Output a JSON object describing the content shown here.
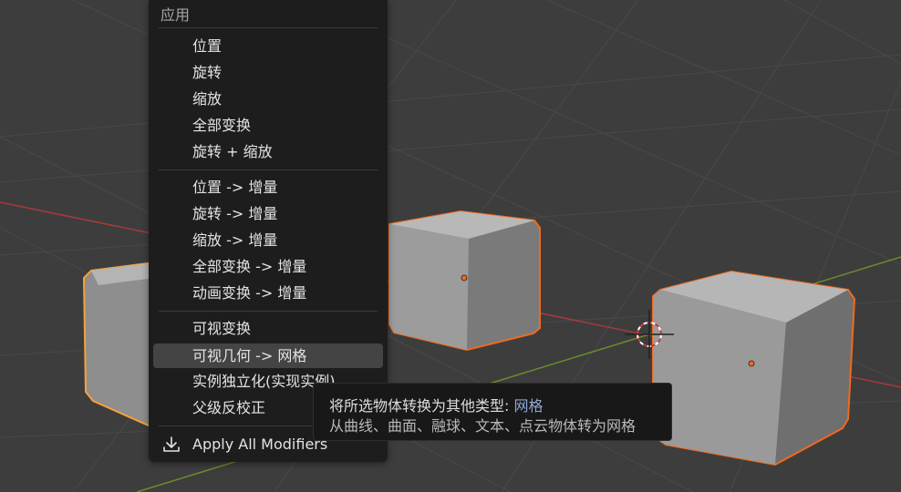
{
  "menu": {
    "title": "应用",
    "items": [
      {
        "label": "位置"
      },
      {
        "label": "旋转"
      },
      {
        "label": "缩放"
      },
      {
        "label": "全部变换"
      },
      {
        "label": "旋转 + 缩放"
      },
      {
        "label": "位置 -> 增量"
      },
      {
        "label": "旋转 -> 增量"
      },
      {
        "label": "缩放 -> 增量"
      },
      {
        "label": "全部变换 -> 增量"
      },
      {
        "label": "动画变换 -> 增量"
      },
      {
        "label": "可视变换"
      },
      {
        "label": "可视几何 -> 网格",
        "highlighted": true
      },
      {
        "label": "实例独立化(实现实例)"
      },
      {
        "label": "父级反校正"
      },
      {
        "label": "Apply All Modifiers",
        "icon": "download-icon"
      }
    ]
  },
  "tooltip": {
    "prefix": "将所选物体转换为其他类型: ",
    "accent": "网格",
    "description": "从曲线、曲面、融球、文本、点云物体转为网格"
  },
  "viewport": {
    "background": "#3d3d3d",
    "selection_outline": "#f06a1d",
    "active_outline": "#f7a13a",
    "x_axis_color": "#a83a3a",
    "y_axis_color": "#6c8c2c"
  }
}
